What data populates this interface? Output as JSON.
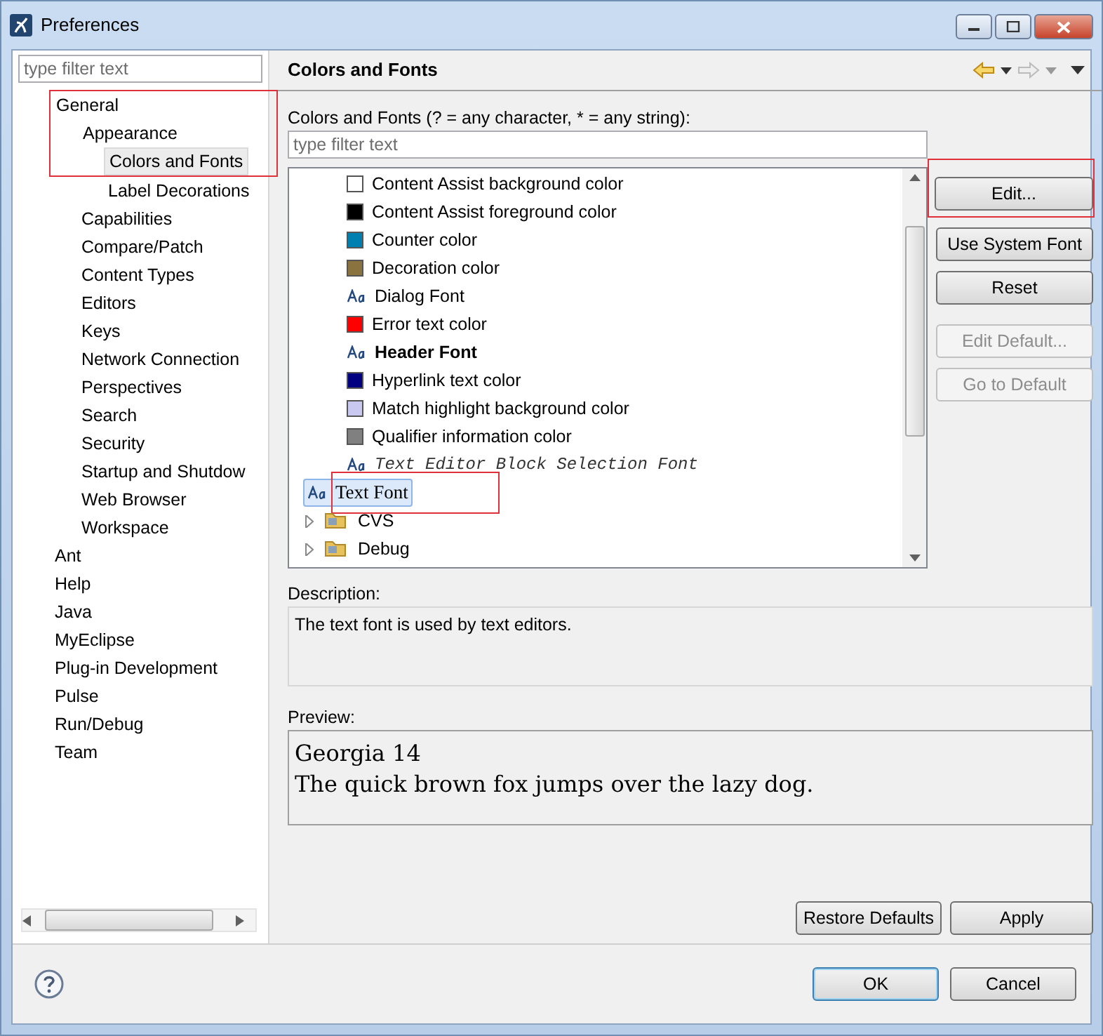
{
  "window": {
    "title": "Preferences"
  },
  "sidebar": {
    "filter": {
      "placeholder": "type filter text"
    },
    "tree": [
      {
        "label": "General",
        "selected": false,
        "highlighted": true,
        "children": [
          {
            "label": "Appearance",
            "selected": false,
            "highlighted": true,
            "children": [
              {
                "label": "Colors and Fonts",
                "selected": true,
                "highlighted": true
              },
              {
                "label": "Label Decorations",
                "selected": false,
                "highlighted": false
              }
            ]
          },
          {
            "label": "Capabilities",
            "selected": false,
            "highlighted": false
          },
          {
            "label": "Compare/Patch",
            "selected": false,
            "highlighted": false
          },
          {
            "label": "Content Types",
            "selected": false,
            "highlighted": false
          },
          {
            "label": "Editors",
            "selected": false,
            "highlighted": false
          },
          {
            "label": "Keys",
            "selected": false,
            "highlighted": false
          },
          {
            "label": "Network Connection",
            "selected": false,
            "highlighted": false
          },
          {
            "label": "Perspectives",
            "selected": false,
            "highlighted": false
          },
          {
            "label": "Search",
            "selected": false,
            "highlighted": false
          },
          {
            "label": "Security",
            "selected": false,
            "highlighted": false
          },
          {
            "label": "Startup and Shutdow",
            "selected": false,
            "highlighted": false
          },
          {
            "label": "Web Browser",
            "selected": false,
            "highlighted": false
          },
          {
            "label": "Workspace",
            "selected": false,
            "highlighted": false
          }
        ]
      },
      {
        "label": "Ant",
        "selected": false,
        "highlighted": false
      },
      {
        "label": "Help",
        "selected": false,
        "highlighted": false
      },
      {
        "label": "Java",
        "selected": false,
        "highlighted": false
      },
      {
        "label": "MyEclipse",
        "selected": false,
        "highlighted": false
      },
      {
        "label": "Plug-in Development",
        "selected": false,
        "highlighted": false
      },
      {
        "label": "Pulse",
        "selected": false,
        "highlighted": false
      },
      {
        "label": "Run/Debug",
        "selected": false,
        "highlighted": false
      },
      {
        "label": "Team",
        "selected": false,
        "highlighted": false
      }
    ]
  },
  "page": {
    "title": "Colors and Fonts",
    "filter_label": "Colors and Fonts (? = any character, * = any string):",
    "filter": {
      "placeholder": "type filter text"
    },
    "items": [
      {
        "kind": "color",
        "label": "Content Assist background color",
        "color": "#ffffff",
        "selected": false,
        "highlighted": false
      },
      {
        "kind": "color",
        "label": "Content Assist foreground color",
        "color": "#000000",
        "selected": false,
        "highlighted": false
      },
      {
        "kind": "color",
        "label": "Counter color",
        "color": "#0080b0",
        "selected": false,
        "highlighted": false
      },
      {
        "kind": "color",
        "label": "Decoration color",
        "color": "#8b7340",
        "selected": false,
        "highlighted": false
      },
      {
        "kind": "font",
        "label": "Dialog Font",
        "selected": false,
        "highlighted": false
      },
      {
        "kind": "color",
        "label": "Error text color",
        "color": "#ff0000",
        "selected": false,
        "highlighted": false
      },
      {
        "kind": "boldfont",
        "label": "Header Font",
        "selected": false,
        "highlighted": false
      },
      {
        "kind": "color",
        "label": "Hyperlink text color",
        "color": "#000080",
        "selected": false,
        "highlighted": false
      },
      {
        "kind": "color",
        "label": "Match highlight background color",
        "color": "#c8c8f0",
        "selected": false,
        "highlighted": false
      },
      {
        "kind": "color",
        "label": "Qualifier information color",
        "color": "#808080",
        "selected": false,
        "highlighted": false
      },
      {
        "kind": "monofont",
        "label": "Text Editor Block Selection Font",
        "selected": false,
        "highlighted": false
      },
      {
        "kind": "seriffont",
        "label": "Text Font",
        "selected": true,
        "highlighted": true
      },
      {
        "kind": "category",
        "label": "CVS",
        "expanded": false,
        "selected": false,
        "highlighted": false
      },
      {
        "kind": "category",
        "label": "Debug",
        "expanded": false,
        "selected": false,
        "highlighted": false
      }
    ],
    "buttons": [
      {
        "label": "Edit...",
        "disabled": false,
        "highlighted": true
      },
      {
        "label": "Use System Font",
        "disabled": false,
        "highlighted": false
      },
      {
        "label": "Reset",
        "disabled": false,
        "highlighted": false
      },
      {
        "label": "Edit Default...",
        "disabled": true,
        "highlighted": false
      },
      {
        "label": "Go to Default",
        "disabled": true,
        "highlighted": false
      }
    ],
    "description_label": "Description:",
    "description": "The text font is used by text editors.",
    "preview_label": "Preview:",
    "preview": [
      "Georgia 14",
      "The quick brown fox jumps over the lazy dog."
    ],
    "page_buttons": [
      "Restore Defaults",
      "Apply"
    ]
  },
  "dialog_buttons": [
    {
      "label": "OK",
      "default": true
    },
    {
      "label": "Cancel",
      "default": false
    }
  ]
}
